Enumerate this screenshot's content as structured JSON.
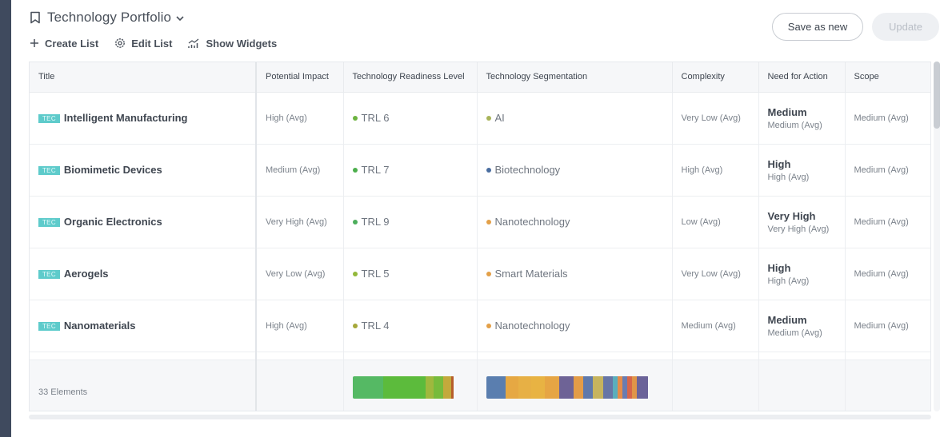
{
  "header": {
    "title": "Technology Portfolio",
    "actions": [
      {
        "label": "Create List",
        "icon": "plus-icon"
      },
      {
        "label": "Edit List",
        "icon": "gear-icon"
      },
      {
        "label": "Show Widgets",
        "icon": "chart-icon"
      }
    ],
    "save_as_new_label": "Save as new",
    "update_label": "Update"
  },
  "table": {
    "columns": [
      "Title",
      "Potential Impact",
      "Technology Readiness Level",
      "Technology Segmentation",
      "Complexity",
      "Need for Action",
      "Scope"
    ],
    "badge": "TEC",
    "rows": [
      {
        "title": "Intelligent Manufacturing",
        "impact": "High (Avg)",
        "trl": "TRL 6",
        "trl_color": "#6cb33f",
        "segment": "AI",
        "segment_color": "#a8b45a",
        "complexity": "Very Low (Avg)",
        "nfa_main": "Medium",
        "nfa_sub": "Medium (Avg)",
        "scope": "Medium (Avg)"
      },
      {
        "title": "Biomimetic Devices",
        "impact": "Medium (Avg)",
        "trl": "TRL 7",
        "trl_color": "#4cae4c",
        "segment": "Biotechnology",
        "segment_color": "#4a6ea0",
        "complexity": "High (Avg)",
        "nfa_main": "High",
        "nfa_sub": "High (Avg)",
        "scope": "Medium (Avg)"
      },
      {
        "title": "Organic Electronics",
        "impact": "Very High (Avg)",
        "trl": "TRL 9",
        "trl_color": "#4cae5c",
        "segment": "Nanotechnology",
        "segment_color": "#e3a048",
        "complexity": "Low (Avg)",
        "nfa_main": "Very High",
        "nfa_sub": "Very High (Avg)",
        "scope": "Medium (Avg)"
      },
      {
        "title": "Aerogels",
        "impact": "Very Low (Avg)",
        "trl": "TRL 5",
        "trl_color": "#93b83a",
        "segment": "Smart Materials",
        "segment_color": "#e3a048",
        "complexity": "Very Low (Avg)",
        "nfa_main": "High",
        "nfa_sub": "High (Avg)",
        "scope": "Medium (Avg)"
      },
      {
        "title": "Nanomaterials",
        "impact": "High (Avg)",
        "trl": "TRL 4",
        "trl_color": "#a6a83a",
        "segment": "Nanotechnology",
        "segment_color": "#e3a048",
        "complexity": "Medium (Avg)",
        "nfa_main": "Medium",
        "nfa_sub": "Medium (Avg)",
        "scope": "Medium (Avg)"
      }
    ],
    "footer": {
      "count_label": "33 Elements",
      "trl_distribution": [
        {
          "share": 0.3,
          "color": "#55b964"
        },
        {
          "share": 0.42,
          "color": "#5cbb3c"
        },
        {
          "share": 0.08,
          "color": "#9fb83e"
        },
        {
          "share": 0.09,
          "color": "#77bb3c"
        },
        {
          "share": 0.08,
          "color": "#c3a93c"
        },
        {
          "share": 0.03,
          "color": "#b65d2a"
        }
      ],
      "segment_distribution": [
        {
          "share": 0.12,
          "color": "#5a7eaf"
        },
        {
          "share": 0.08,
          "color": "#e6a843"
        },
        {
          "share": 0.08,
          "color": "#e7b045"
        },
        {
          "share": 0.08,
          "color": "#e8b343"
        },
        {
          "share": 0.09,
          "color": "#e6a544"
        },
        {
          "share": 0.09,
          "color": "#6e6396"
        },
        {
          "share": 0.06,
          "color": "#e39c47"
        },
        {
          "share": 0.06,
          "color": "#5f79ab"
        },
        {
          "share": 0.06,
          "color": "#c6b45e"
        },
        {
          "share": 0.06,
          "color": "#6776a6"
        },
        {
          "share": 0.03,
          "color": "#5aaebc"
        },
        {
          "share": 0.03,
          "color": "#e38c4a"
        },
        {
          "share": 0.03,
          "color": "#6a7cb0"
        },
        {
          "share": 0.03,
          "color": "#d6664a"
        },
        {
          "share": 0.03,
          "color": "#e09548"
        },
        {
          "share": 0.07,
          "color": "#6b6399"
        }
      ]
    }
  }
}
